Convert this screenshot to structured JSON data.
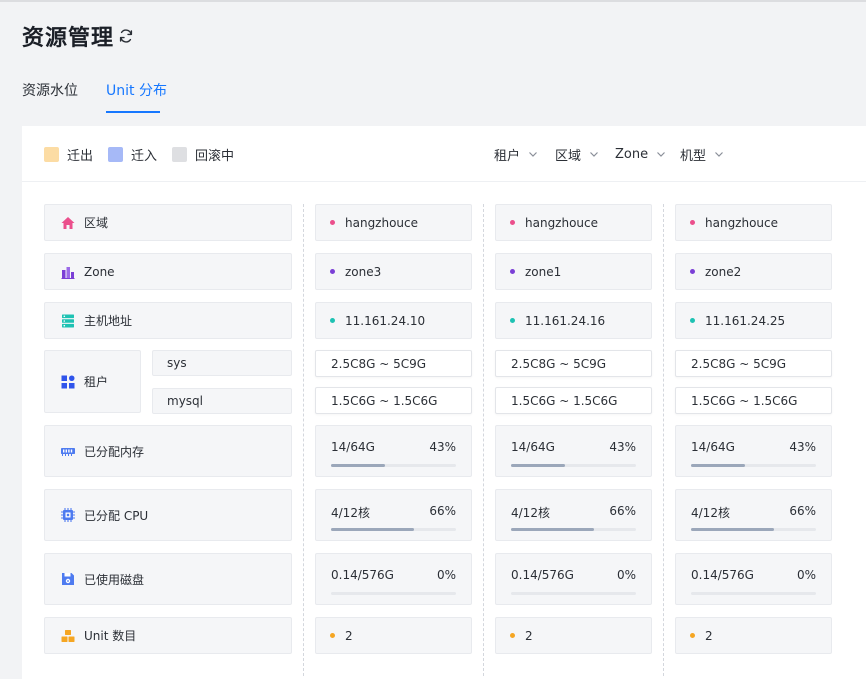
{
  "header": {
    "title": "资源管理",
    "refresh_icon": "refresh-icon"
  },
  "tabs": [
    {
      "label": "资源水位",
      "active": false
    },
    {
      "label": "Unit 分布",
      "active": true
    }
  ],
  "legend": [
    {
      "label": "迁出",
      "color": "#fcdca4"
    },
    {
      "label": "迁入",
      "color": "#a6b9f7"
    },
    {
      "label": "回滚中",
      "color": "#dedfe2"
    }
  ],
  "filters": [
    {
      "label": "租户",
      "icon": "chevron-down-icon"
    },
    {
      "label": "区域",
      "icon": "chevron-down-icon"
    },
    {
      "label": "Zone",
      "icon": "chevron-down-icon"
    },
    {
      "label": "机型",
      "icon": "chevron-down-icon"
    }
  ],
  "rows": {
    "region": {
      "label": "区域",
      "icon": "home-icon",
      "color": "#eb4f8c"
    },
    "zone": {
      "label": "Zone",
      "icon": "bar-chart-icon",
      "color": "#7b3fd6"
    },
    "host": {
      "label": "主机地址",
      "icon": "server-icon",
      "color": "#1ec2b3"
    },
    "tenant": {
      "label": "租户",
      "icon": "apps-icon",
      "color": "#2f54eb",
      "subs": [
        "sys",
        "mysql"
      ]
    },
    "memory": {
      "label": "已分配内存",
      "icon": "memory-icon",
      "color": "#4e7bf0"
    },
    "cpu": {
      "label": "已分配 CPU",
      "icon": "cpu-icon",
      "color": "#4e7bf0"
    },
    "disk": {
      "label": "已使用磁盘",
      "icon": "disk-icon",
      "color": "#4e7bf0"
    },
    "unit": {
      "label": "Unit 数目",
      "icon": "cubes-icon",
      "color": "#f5a623"
    }
  },
  "dot_colors": {
    "region": "#eb4f8c",
    "zone": "#7b3fd6",
    "host": "#1ec2b3",
    "unit": "#f5a623"
  },
  "servers": [
    {
      "region": "hangzhouce",
      "zone": "zone3",
      "host": "11.161.24.10",
      "sys": "2.5C8G ~ 5C9G",
      "mysql": "1.5C6G ~ 1.5C6G",
      "memory": {
        "text": "14/64G",
        "pct": "43%",
        "value": 0.43
      },
      "cpu": {
        "text": "4/12核",
        "pct": "66%",
        "value": 0.66
      },
      "disk": {
        "text": "0.14/576G",
        "pct": "0%",
        "value": 0
      },
      "units": "2"
    },
    {
      "region": "hangzhouce",
      "zone": "zone1",
      "host": "11.161.24.16",
      "sys": "2.5C8G ~ 5C9G",
      "mysql": "1.5C6G ~ 1.5C6G",
      "memory": {
        "text": "14/64G",
        "pct": "43%",
        "value": 0.43
      },
      "cpu": {
        "text": "4/12核",
        "pct": "66%",
        "value": 0.66
      },
      "disk": {
        "text": "0.14/576G",
        "pct": "0%",
        "value": 0
      },
      "units": "2"
    },
    {
      "region": "hangzhouce",
      "zone": "zone2",
      "host": "11.161.24.25",
      "sys": "2.5C8G ~ 5C9G",
      "mysql": "1.5C6G ~ 1.5C6G",
      "memory": {
        "text": "14/64G",
        "pct": "43%",
        "value": 0.43
      },
      "cpu": {
        "text": "4/12核",
        "pct": "66%",
        "value": 0.66
      },
      "disk": {
        "text": "0.14/576G",
        "pct": "0%",
        "value": 0
      },
      "units": "2"
    }
  ]
}
